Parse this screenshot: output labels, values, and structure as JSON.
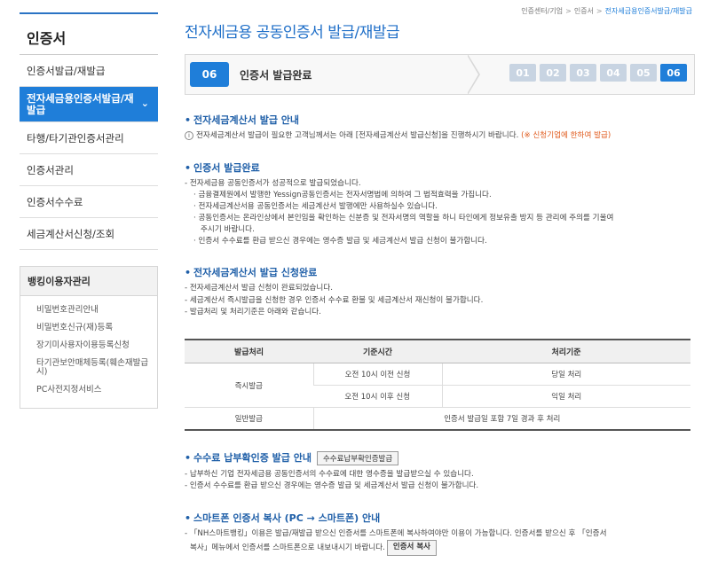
{
  "breadcrumb": [
    "인증센터/기업",
    "인증서",
    "전자세금용인증서발급/재발급"
  ],
  "sidebar": {
    "title": "인증서",
    "items": [
      {
        "label": "인증서발급/재발급"
      },
      {
        "label": "전자세금용인증서발급/재발급",
        "active": true
      },
      {
        "label": "타행/타기관인증서관리"
      },
      {
        "label": "인증서관리"
      },
      {
        "label": "인증서수수료"
      },
      {
        "label": "세금계산서신청/조회"
      }
    ],
    "banking": {
      "title": "뱅킹이용자관리",
      "items": [
        "비밀번호관리안내",
        "비밀번호신규(재)등록",
        "장기미사용자이용등록신청",
        "타기관보안매체등록(훼손재발급시)",
        "PC사전지정서비스"
      ]
    }
  },
  "page_title": "전자세금용 공동인증서 발급/재발급",
  "steps": {
    "current_num": "06",
    "current_label": "인증서 발급완료",
    "list": [
      "01",
      "02",
      "03",
      "04",
      "05",
      "06"
    ]
  },
  "sections": {
    "guide": {
      "title": "전자세금계산서 발급 안내",
      "text": "전자세금계산서 발급이 필요한 고객님께서는 아래 [전자세금계산서 발급신청]을 진행하시기 바랍니다.",
      "warn": "(※ 신청기업에 한하여 발급)"
    },
    "complete": {
      "title": "인증서 발급완료",
      "lead": "- 전자세금용 공동인증서가 성공적으로 발급되었습니다.",
      "bullets": [
        "· 금융결제원에서 발행한 Yessign공동인증서는 전자서명법에 의하여 그 법적효력을 가집니다.",
        "· 전자세금계산서용 공동인증서는 세금계산서 발행에만 사용하실수 있습니다.",
        "· 공동인증서는 온라인상에서 본인임을 확인하는 신분증 및 전자서명의 역할을 하니 타인에게 정보유출 방지 등 관리에 주의를 기울여",
        "  주시기 바랍니다.",
        "· 인증서 수수료를 환급 받으신 경우에는 영수증 발급 및 세금계산서 발급 신청이 불가합니다."
      ]
    },
    "apply": {
      "title": "전자세금계산서 발급 신청완료",
      "lines": [
        "- 전자세금계산서 발급 신청이 완료되었습니다.",
        "- 세금계산서 즉시발급을 신청한 경우 인증서 수수료 환불 및 세금계산서 재신청이 불가합니다.",
        "- 발급처리 및 처리기준은 아래와 같습니다."
      ]
    },
    "fee": {
      "title": "수수료 납부확인증 발급 안내",
      "button": "수수료납부확인증발급",
      "lines": [
        "- 납부하신 기업 전자세금용 공동인증서의 수수료에 대한 영수증을 발급받으실 수 있습니다.",
        "- 인증서 수수료를 환급 받으신 경우에는 영수증 발급 및 세금계산서 발급 신청이 불가합니다."
      ]
    },
    "smartphone": {
      "title": "스마트폰 인증서 복사 (PC → 스마트폰) 안내",
      "line1": "- 「NH스마트뱅킹」이용은 발급/재발급 받으신 인증서를 스마트폰에 복사하여야만 이용이 가능합니다. 인증서를 받으신 후 「인증서",
      "line2": "복사」메뉴에서 인증서를 스마트폰으로 내보내시기 바랍니다.",
      "button": "인증서 복사"
    }
  },
  "table": {
    "headers": [
      "발급처리",
      "기준시간",
      "처리기준"
    ],
    "rows": [
      [
        "즉시발급",
        "오전 10시 이전 신청",
        "당일 처리"
      ],
      [
        "",
        "오전 10시 이후 신청",
        "익일 처리"
      ],
      [
        "일반발급",
        "인증서 발급일 포함 7일 경과 후 처리"
      ]
    ]
  }
}
